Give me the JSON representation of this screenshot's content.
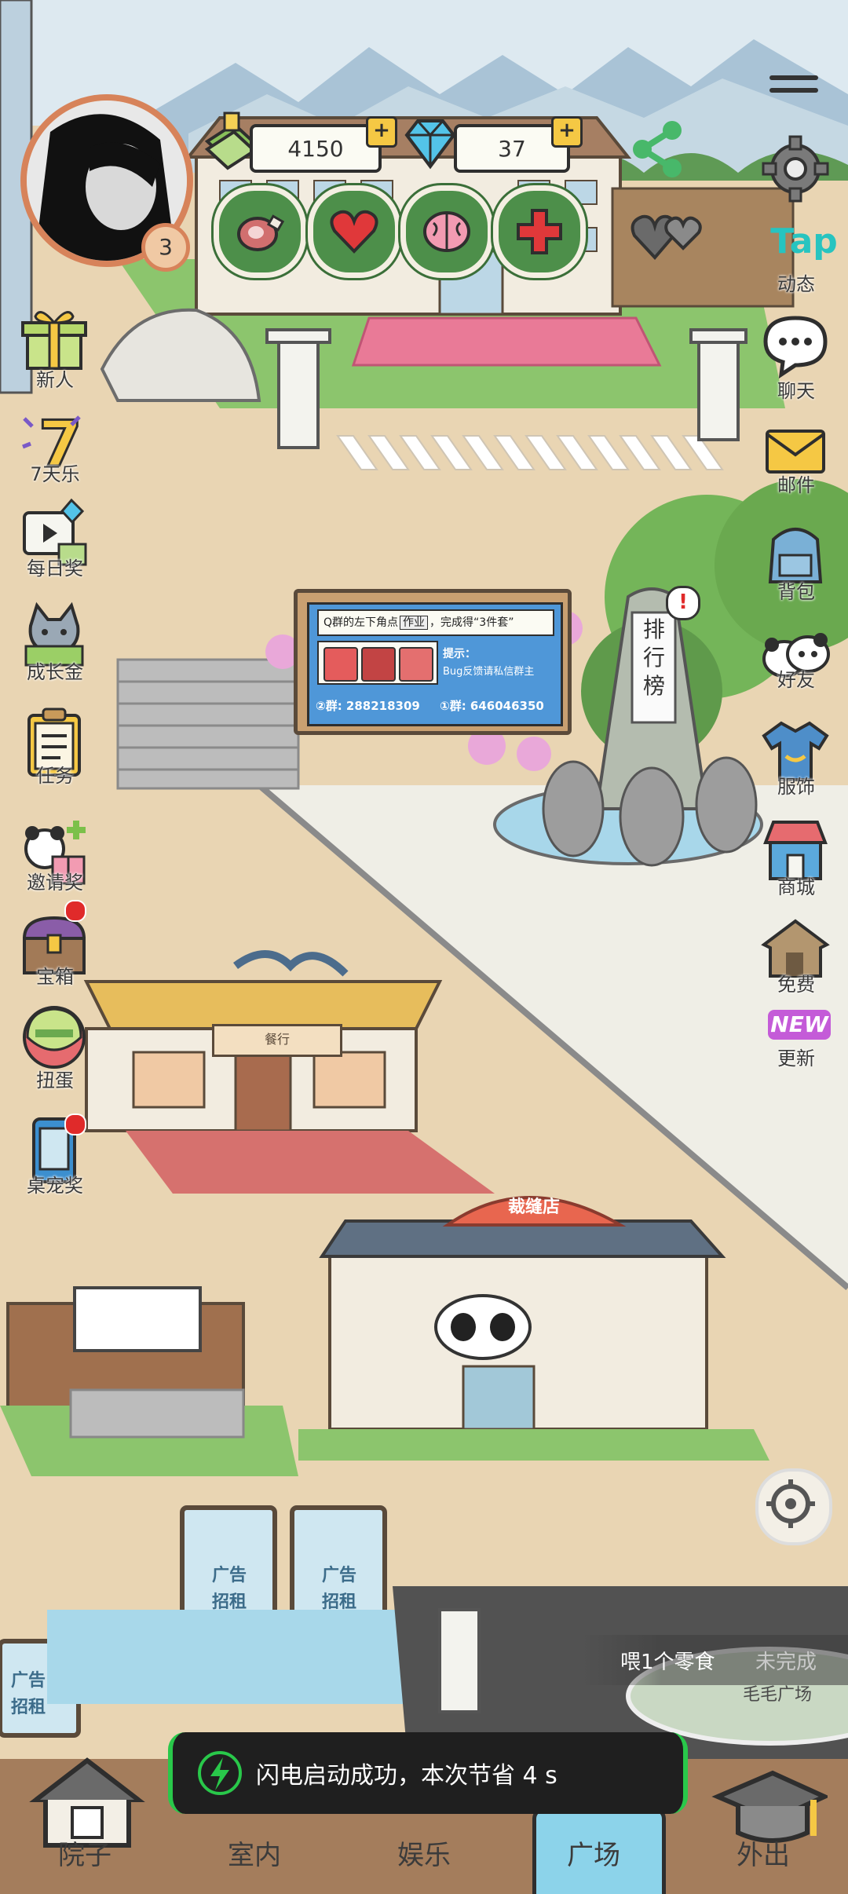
{
  "header": {
    "money": "4150",
    "diamonds": "37",
    "level": "3"
  },
  "left_menu": [
    {
      "label": "新人"
    },
    {
      "label": "7天乐"
    },
    {
      "label": "每日奖"
    },
    {
      "label": "成长金"
    },
    {
      "label": "任务"
    },
    {
      "label": "邀请奖"
    },
    {
      "label": "宝箱"
    },
    {
      "label": "扭蛋"
    },
    {
      "label": "桌宠奖"
    }
  ],
  "right_menu": [
    {
      "label": "动态",
      "badge": "Tap"
    },
    {
      "label": "聊天"
    },
    {
      "label": "邮件"
    },
    {
      "label": "背包"
    },
    {
      "label": "好友"
    },
    {
      "label": "服饰"
    },
    {
      "label": "商城"
    },
    {
      "label": "免费"
    },
    {
      "label": "更新",
      "badge": "NEW"
    }
  ],
  "billboard": {
    "line1": "Q群的左下角点",
    "chip": "作业",
    "line1b": "，完成得“3件套”",
    "hint_title": "提示：",
    "hint_body": "Bug反馈请私信群主",
    "group2": "②群: 288218309",
    "group1": "①群: 646046350"
  },
  "monument": "排行榜",
  "restaurant_sign": "餐行",
  "tailor_sign": "裁缝店",
  "ad_text": "广告招租",
  "quest": {
    "text": "喂1个零食",
    "status": "未完成"
  },
  "location": "毛毛广场",
  "toast": "闪电启动成功，本次节省 4 s",
  "bottom_nav": [
    {
      "label": "院子"
    },
    {
      "label": "室内"
    },
    {
      "label": "娱乐"
    },
    {
      "label": "广场"
    },
    {
      "label": "外出"
    }
  ],
  "colors": {
    "accent_green": "#4d8f4a",
    "ground": "#e9d5b3",
    "sky": "#dde9f0",
    "tap_teal": "#27c4c0",
    "new_purple": "#c45bd8",
    "red_badge": "#e02a2a"
  }
}
